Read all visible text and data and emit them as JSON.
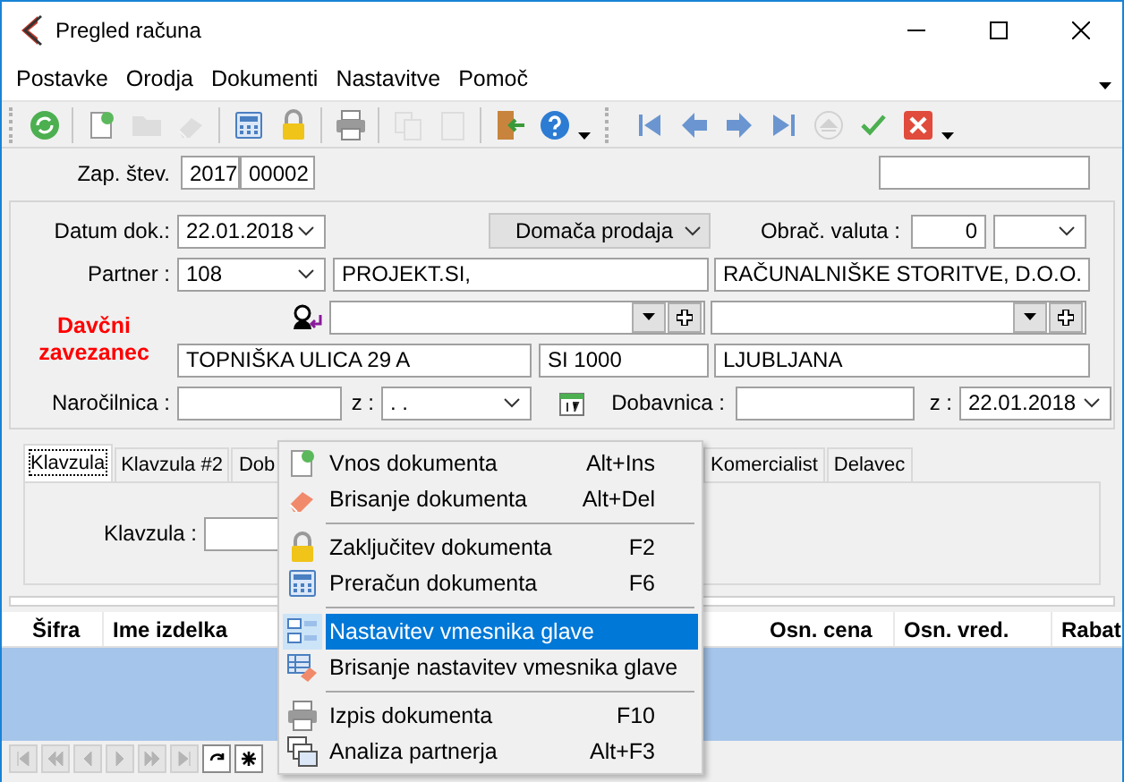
{
  "window": {
    "title": "Pregled računa"
  },
  "menu": [
    {
      "label": "Postavke"
    },
    {
      "label": "Orodja"
    },
    {
      "label": "Dokumenti"
    },
    {
      "label": "Nastavitve"
    },
    {
      "label": "Pomoč"
    }
  ],
  "toolbar": [
    {
      "kind": "refresh",
      "disabled": false
    },
    {
      "kind": "sep"
    },
    {
      "kind": "new",
      "disabled": false
    },
    {
      "kind": "folder",
      "disabled": true
    },
    {
      "kind": "eraser",
      "disabled": true
    },
    {
      "kind": "sep"
    },
    {
      "kind": "calculator",
      "disabled": false
    },
    {
      "kind": "lock",
      "disabled": false
    },
    {
      "kind": "sep"
    },
    {
      "kind": "printer",
      "disabled": false
    },
    {
      "kind": "sep"
    },
    {
      "kind": "copy",
      "disabled": true
    },
    {
      "kind": "paste",
      "disabled": true
    },
    {
      "kind": "sep"
    },
    {
      "kind": "exit",
      "disabled": false
    },
    {
      "kind": "help",
      "disabled": false
    },
    {
      "kind": "more"
    },
    {
      "kind": "grip"
    },
    {
      "kind": "first",
      "disabled": false
    },
    {
      "kind": "prev",
      "disabled": false
    },
    {
      "kind": "next",
      "disabled": false
    },
    {
      "kind": "last",
      "disabled": false
    },
    {
      "kind": "eject",
      "disabled": true
    },
    {
      "kind": "check",
      "disabled": false
    },
    {
      "kind": "cancel",
      "disabled": false
    },
    {
      "kind": "more"
    }
  ],
  "header": {
    "label": "Zap. štev.",
    "year": "2017",
    "number": "00002"
  },
  "form": {
    "document_date": {
      "label": "Datum dok.:",
      "value": "22.01.2018"
    },
    "sale_type": "Domača prodaja",
    "currency": {
      "label": "Obrač. valuta :",
      "value": "0"
    },
    "partner": {
      "label": "Partner :",
      "code": "108",
      "name": "PROJEKT.SI,",
      "name_2": "RAČUNALNIŠKE STORITVE, D.O.O."
    },
    "tax_status": "Davčni zavezanec",
    "address": {
      "street": "TOPNIŠKA ULICA 29 A",
      "post": "SI 1000",
      "city": "LJUBLJANA"
    },
    "order": {
      "label": "Naročilnica :",
      "date_label": "z :",
      "date": ". ."
    },
    "delivery": {
      "label": "Dobavnica :",
      "date_label": "z :",
      "date": "22.01.2018"
    }
  },
  "tabs": [
    {
      "label": "Klavzula",
      "selected": true
    },
    {
      "label": "Klavzula #2",
      "selected": false
    },
    {
      "label": "Dob",
      "selected": false
    },
    {
      "label": "Komercialist",
      "selected": false
    },
    {
      "label": "Delavec",
      "selected": false
    }
  ],
  "clause": {
    "label": "Klavzula :"
  },
  "grid": {
    "columns": [
      {
        "label": "Šifra"
      },
      {
        "label": "Ime izdelka"
      },
      {
        "label": "Osn. cena"
      },
      {
        "label": "Osn. vred."
      },
      {
        "label": "Rabat"
      }
    ],
    "nav": [
      {
        "kind": "first",
        "disabled": true
      },
      {
        "kind": "prev-page",
        "disabled": true
      },
      {
        "kind": "prev",
        "disabled": true
      },
      {
        "kind": "next",
        "disabled": true
      },
      {
        "kind": "next-page",
        "disabled": true
      },
      {
        "kind": "last",
        "disabled": true
      },
      {
        "kind": "refresh",
        "disabled": false
      },
      {
        "kind": "star",
        "disabled": false
      }
    ]
  },
  "context_menu": {
    "items": [
      {
        "kind": "new",
        "label": "Vnos dokumenta",
        "shortcut": "Alt+Ins",
        "selected": false
      },
      {
        "kind": "eraser",
        "label": "Brisanje dokumenta",
        "shortcut": "Alt+Del",
        "selected": false
      },
      {
        "kind": "separator"
      },
      {
        "kind": "lock",
        "label": "Zaključitev dokumenta",
        "shortcut": "F2",
        "selected": false
      },
      {
        "kind": "calculator",
        "label": "Preračun dokumenta",
        "shortcut": "F6",
        "selected": false
      },
      {
        "kind": "separator"
      },
      {
        "kind": "layout",
        "label": "Nastavitev vmesnika glave",
        "selected": true
      },
      {
        "kind": "layout-erase",
        "label": "Brisanje nastavitev vmesnika glave",
        "selected": false
      },
      {
        "kind": "separator"
      },
      {
        "kind": "printer",
        "label": "Izpis dokumenta",
        "shortcut": "F10",
        "selected": false
      },
      {
        "kind": "windows",
        "label": "Analiza partnerja",
        "shortcut": "Alt+F3",
        "selected": false
      }
    ]
  }
}
